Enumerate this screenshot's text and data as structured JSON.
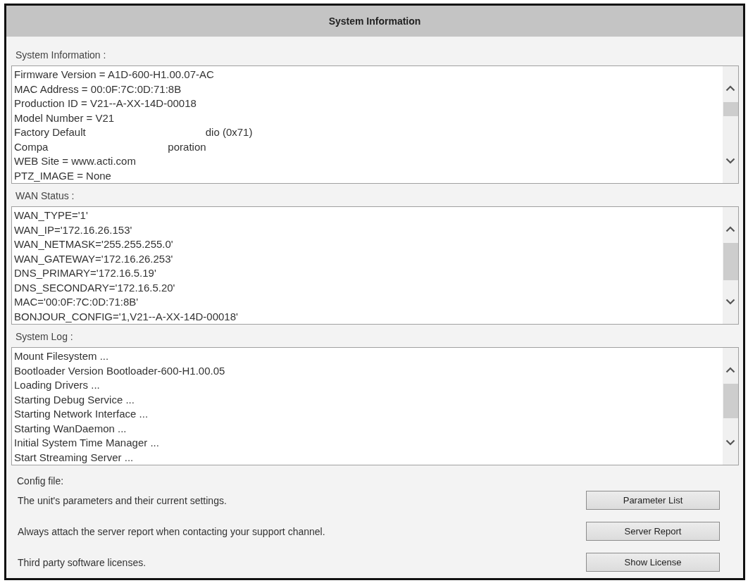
{
  "header": {
    "title": "System Information"
  },
  "sections": [
    {
      "label": "System Information :",
      "lines": [
        {
          "kind": "text",
          "text": "Firmware Version = A1D-600-H1.00.07-AC"
        },
        {
          "kind": "text",
          "text": "MAC Address = 00:0F:7C:0D:71:8B"
        },
        {
          "kind": "text",
          "text": "Production ID = V21--A-XX-14D-00018"
        },
        {
          "kind": "text",
          "text": "Model Number = V21"
        },
        {
          "kind": "redacted",
          "parts": [
            "Factory Default",
            "dio (0x71)"
          ]
        },
        {
          "kind": "redacted",
          "parts": [
            "Compa",
            "poration"
          ]
        },
        {
          "kind": "text",
          "text": "WEB Site = www.acti.com"
        },
        {
          "kind": "text",
          "text": "PTZ_IMAGE = None"
        }
      ]
    },
    {
      "label": "WAN Status :",
      "lines": [
        {
          "kind": "text",
          "text": "WAN_TYPE='1'"
        },
        {
          "kind": "text",
          "text": "WAN_IP='172.16.26.153'"
        },
        {
          "kind": "text",
          "text": "WAN_NETMASK='255.255.255.0'"
        },
        {
          "kind": "text",
          "text": "WAN_GATEWAY='172.16.26.253'"
        },
        {
          "kind": "text",
          "text": "DNS_PRIMARY='172.16.5.19'"
        },
        {
          "kind": "text",
          "text": "DNS_SECONDARY='172.16.5.20'"
        },
        {
          "kind": "text",
          "text": "MAC='00:0F:7C:0D:71:8B'"
        },
        {
          "kind": "text",
          "text": "BONJOUR_CONFIG='1,V21--A-XX-14D-00018'"
        }
      ]
    },
    {
      "label": "System Log :",
      "lines": [
        {
          "kind": "text",
          "text": "Mount Filesystem ..."
        },
        {
          "kind": "text",
          "text": "Bootloader Version Bootloader-600-H1.00.05"
        },
        {
          "kind": "text",
          "text": "Loading Drivers ..."
        },
        {
          "kind": "text",
          "text": "Starting Debug Service ..."
        },
        {
          "kind": "text",
          "text": "Starting Network Interface ..."
        },
        {
          "kind": "text",
          "text": "Starting WanDaemon ..."
        },
        {
          "kind": "text",
          "text": "Initial System Time Manager ..."
        },
        {
          "kind": "text",
          "text": "Start Streaming Server ..."
        }
      ]
    }
  ],
  "config": {
    "label": "Config file:",
    "rows": [
      {
        "description": "The unit's parameters and their current settings.",
        "button": "Parameter List"
      },
      {
        "description": "Always attach the server report when contacting your support channel.",
        "button": "Server Report"
      },
      {
        "description": "Third party software licenses.",
        "button": "Show License"
      }
    ]
  }
}
